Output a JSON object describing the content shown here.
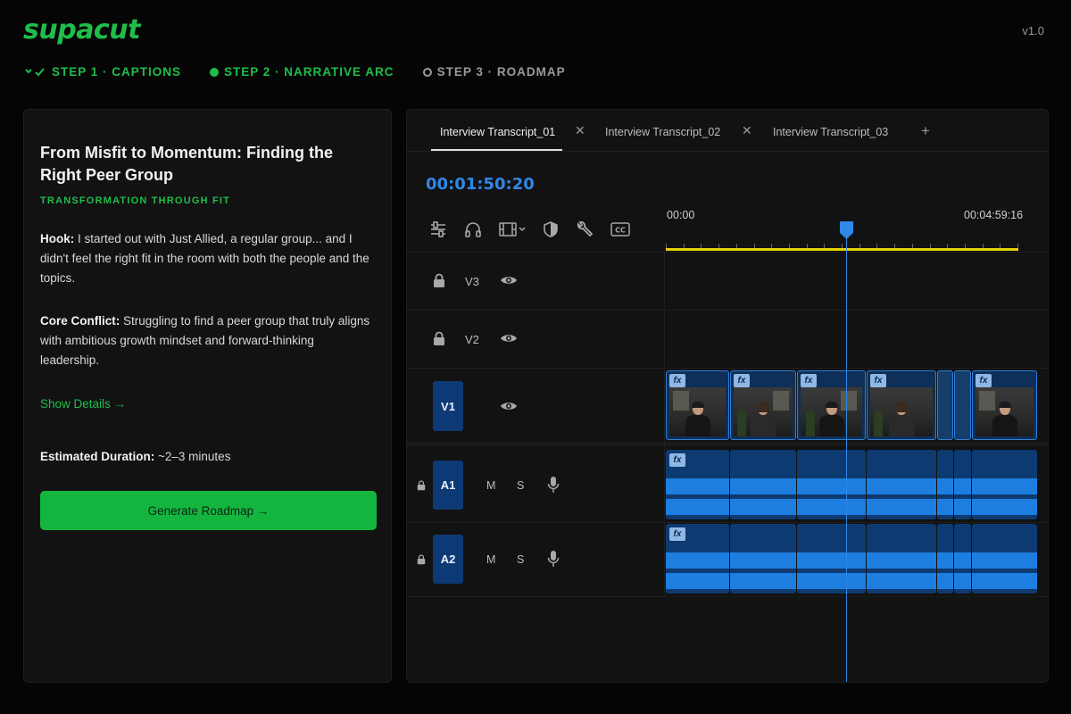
{
  "brand": {
    "logo": "supacut",
    "version": "v1.0"
  },
  "steps": [
    {
      "label": "STEP 1 · CAPTIONS",
      "state": "done"
    },
    {
      "label": "STEP 2 · NARRATIVE ARC",
      "state": "active"
    },
    {
      "label": "STEP 3 · ROADMAP",
      "state": "todo"
    }
  ],
  "story": {
    "title": "From Misfit to Momentum: Finding the Right Peer Group",
    "subtitle": "TRANSFORMATION THROUGH FIT",
    "hook_label": "Hook:",
    "hook_text": " I started out with Just Allied, a regular group... and I didn't feel the right fit in the room with both the people and the topics.",
    "conflict_label": "Core Conflict:",
    "conflict_text": " Struggling to find a peer group that truly aligns with ambitious growth mindset and forward-thinking leadership.",
    "show_details": "Show Details →",
    "duration_label": "Estimated Duration:",
    "duration_text": " ~2–3 minutes",
    "generate_button": "Generate Roadmap →"
  },
  "editor": {
    "tabs": [
      {
        "label": "Interview Transcript_01",
        "active": true
      },
      {
        "label": "Interview Transcript_02",
        "active": false
      },
      {
        "label": "Interview Transcript_03",
        "active": false
      }
    ],
    "tab_close": "✕",
    "tab_add": "+",
    "timecode": "00:01:50:20",
    "ruler_start": "00:00",
    "ruler_end": "00:04:59:16",
    "tools": [
      "settings-sliders-icon",
      "headphones-icon",
      "film-icon",
      "shield-icon",
      "wrench-icon",
      "cc-icon"
    ],
    "cc_label": "CC",
    "tracks": {
      "v3": "V3",
      "v2": "V2",
      "v1": "V1",
      "a1": "A1",
      "a2": "A2",
      "mute": "M",
      "solo": "S"
    },
    "fx_label": "fx",
    "accent": "#2f87e6",
    "brand_green": "#1fbe4a"
  }
}
